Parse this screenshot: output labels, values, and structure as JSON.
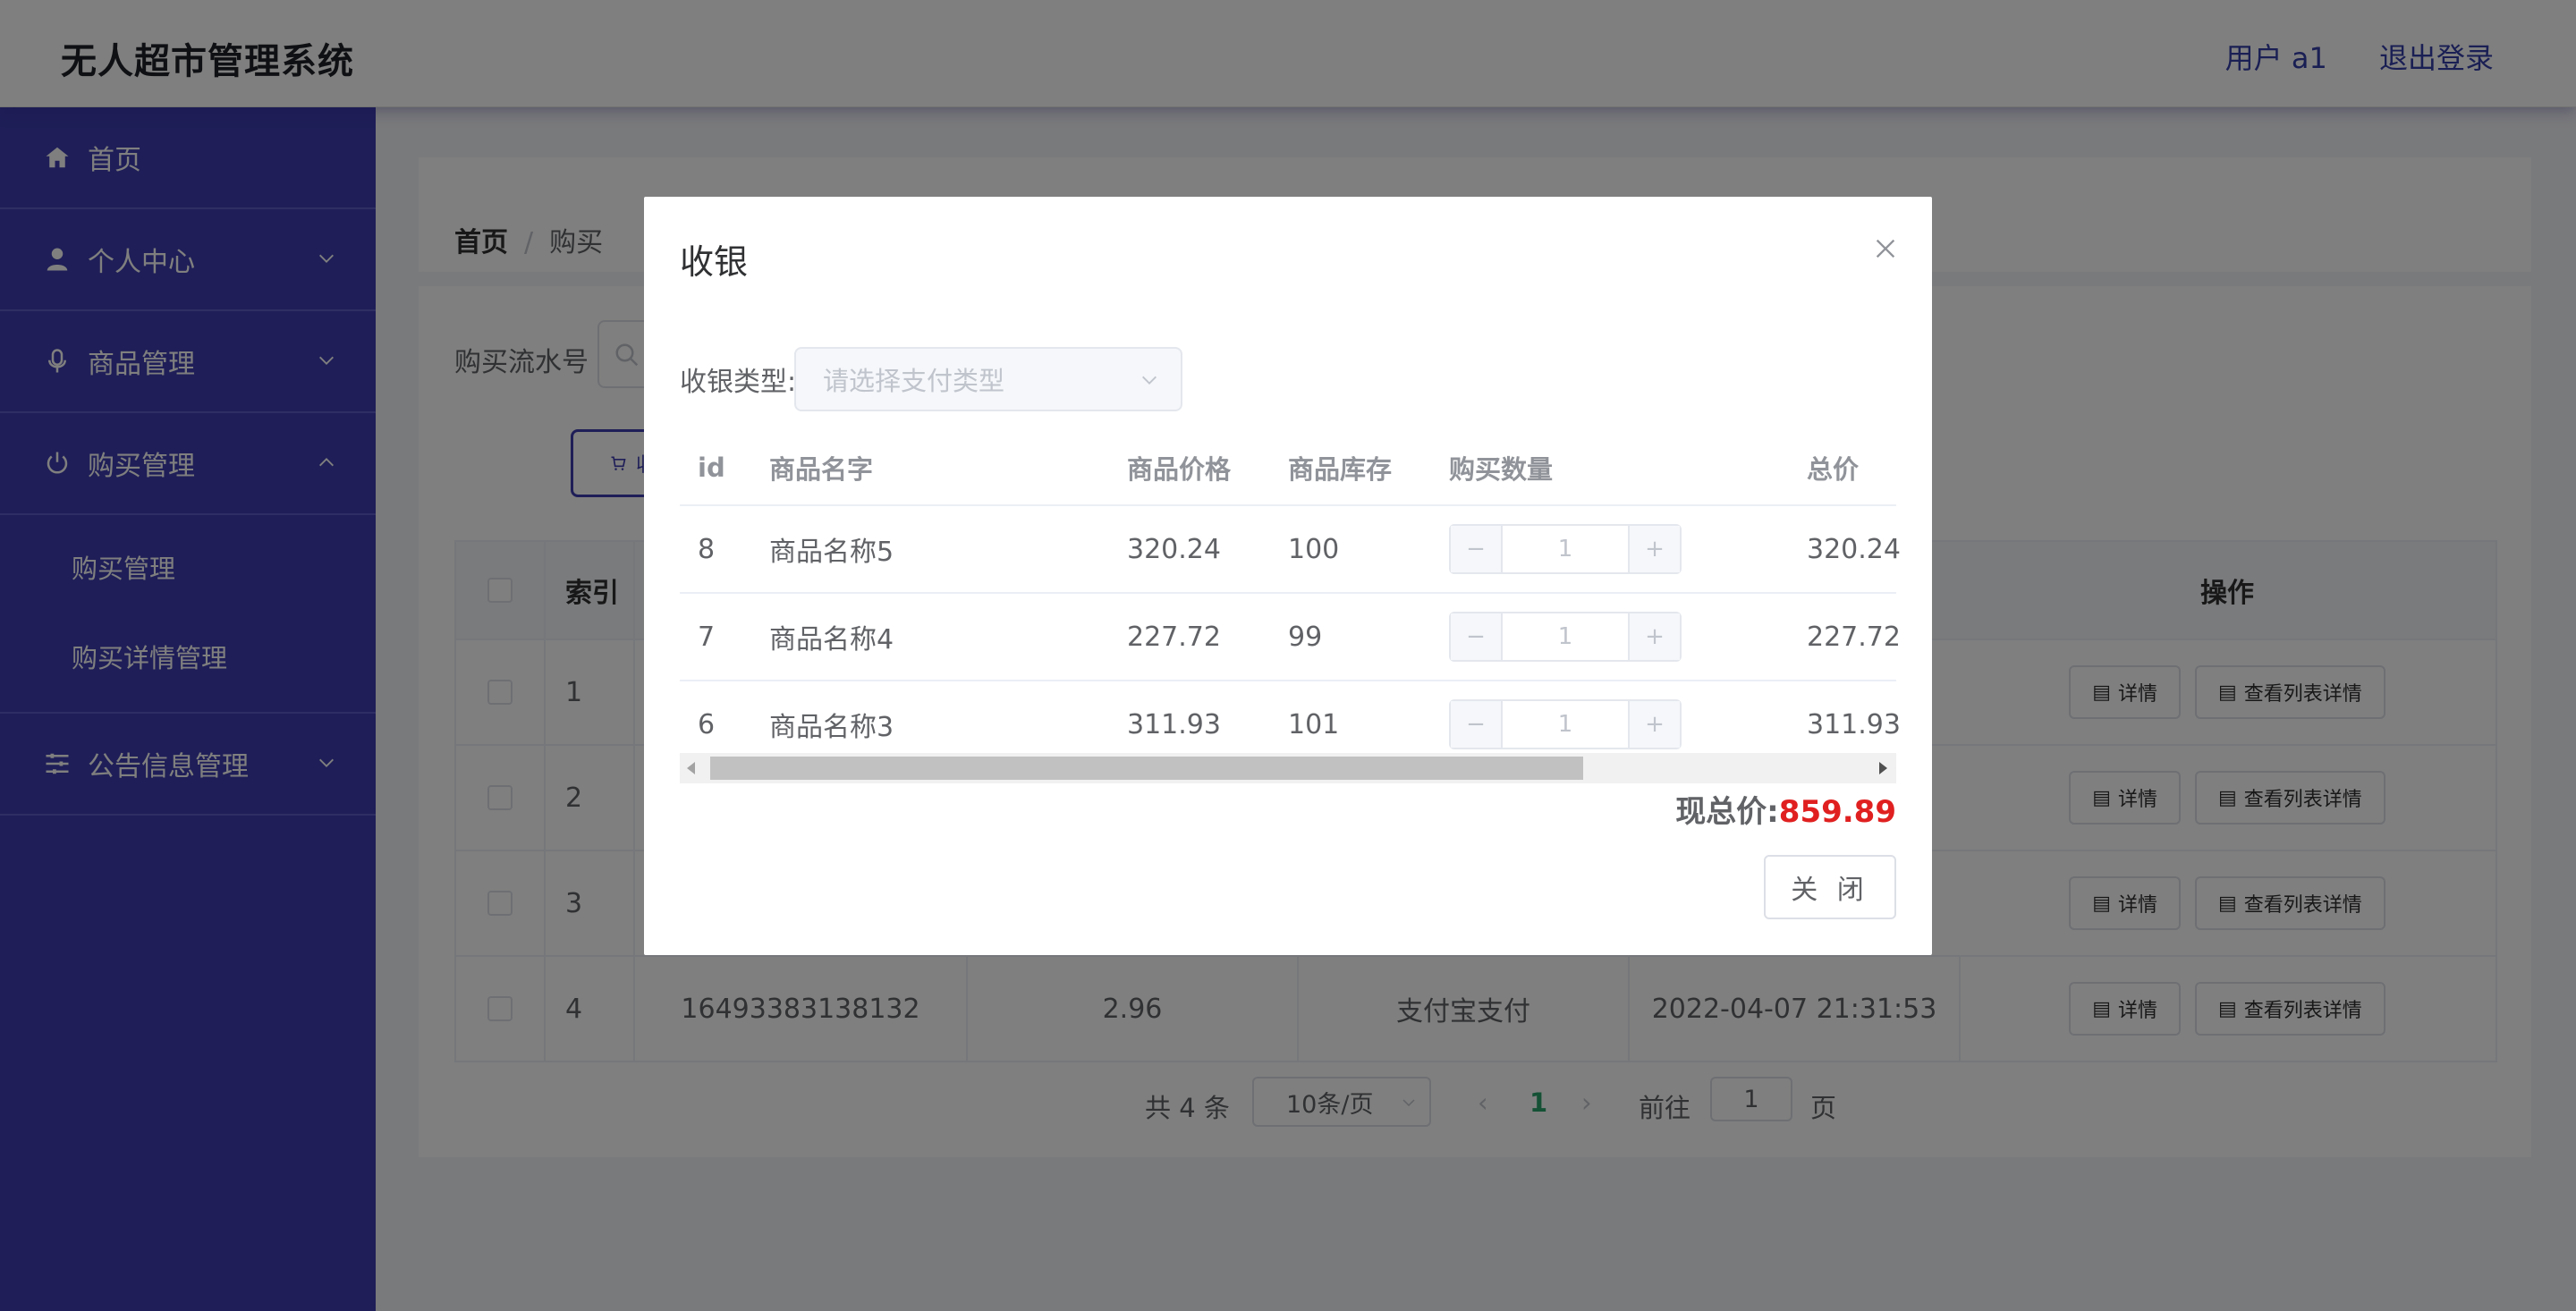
{
  "header": {
    "title": "无人超市管理系统",
    "user_label": "用户 a1",
    "logout_label": "退出登录"
  },
  "sidebar": {
    "items": [
      {
        "label": "首页",
        "icon": "home-icon"
      },
      {
        "label": "个人中心",
        "icon": "user-icon"
      },
      {
        "label": "商品管理",
        "icon": "microphone-icon"
      },
      {
        "label": "购买管理",
        "icon": "power-icon"
      },
      {
        "label": "公告信息管理",
        "icon": "sliders-icon"
      }
    ],
    "submenu": [
      "购买管理",
      "购买详情管理"
    ]
  },
  "breadcrumb": {
    "home": "首页",
    "sep": "/",
    "current": "购买"
  },
  "search": {
    "label": "购买流水号"
  },
  "toolbar": {
    "pay_label": "收银"
  },
  "table": {
    "headers": {
      "index": "索引",
      "ops": "操作"
    },
    "rows": [
      {
        "index": "1",
        "serial": "",
        "amount": "",
        "pay_type": "",
        "time": ""
      },
      {
        "index": "2",
        "serial": "",
        "amount": "",
        "pay_type": "",
        "time": ""
      },
      {
        "index": "3",
        "serial": "",
        "amount": "",
        "pay_type": "",
        "time": ""
      },
      {
        "index": "4",
        "serial": "16493383138132",
        "amount": "2.96",
        "pay_type": "支付宝支付",
        "time": "2022-04-07 21:31:53"
      }
    ],
    "detail_label": "详情",
    "list_detail_label": "查看列表详情"
  },
  "pagination": {
    "total": "共 4 条",
    "page_size": "10条/页",
    "current": "1",
    "goto": "前往",
    "goto_value": "1",
    "page": "页"
  },
  "dialog": {
    "title": "收银",
    "pay_type_label": "收银类型:",
    "pay_type_placeholder": "请选择支付类型",
    "columns": {
      "id": "id",
      "name": "商品名字",
      "price": "商品价格",
      "stock": "商品库存",
      "qty": "购买数量",
      "subtotal": "总价"
    },
    "items": [
      {
        "id": "8",
        "name": "商品名称5",
        "price": "320.24",
        "stock": "100",
        "qty": "1",
        "subtotal": "320.24"
      },
      {
        "id": "7",
        "name": "商品名称4",
        "price": "227.72",
        "stock": "99",
        "qty": "1",
        "subtotal": "227.72"
      },
      {
        "id": "6",
        "name": "商品名称3",
        "price": "311.93",
        "stock": "101",
        "qty": "1",
        "subtotal": "311.93"
      }
    ],
    "stepper_minus": "−",
    "stepper_plus": "+",
    "total_label": "现总价:",
    "total_value": "859.89",
    "close_label": "关 闭"
  },
  "colors": {
    "sidebar": "#3e3db0",
    "accent": "#353fa8",
    "total": "#e02020",
    "page_active": "#2aa36b"
  }
}
